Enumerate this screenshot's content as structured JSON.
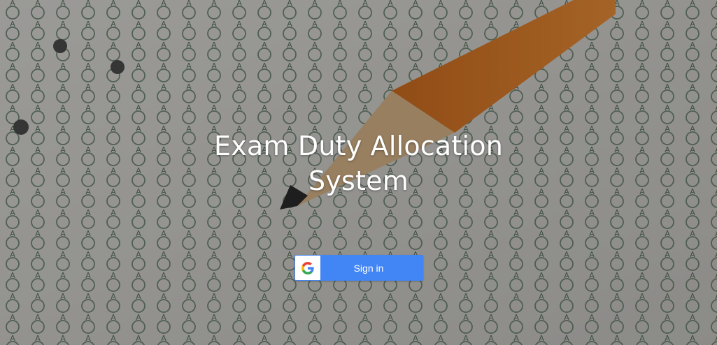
{
  "app": {
    "title_line1": "Exam Duty Allocation",
    "title_line2": "System"
  },
  "signin": {
    "label": "Sign in",
    "icon": "google-g-icon"
  },
  "colors": {
    "button_blue": "#4285f4",
    "title_text": "#ffffff"
  }
}
